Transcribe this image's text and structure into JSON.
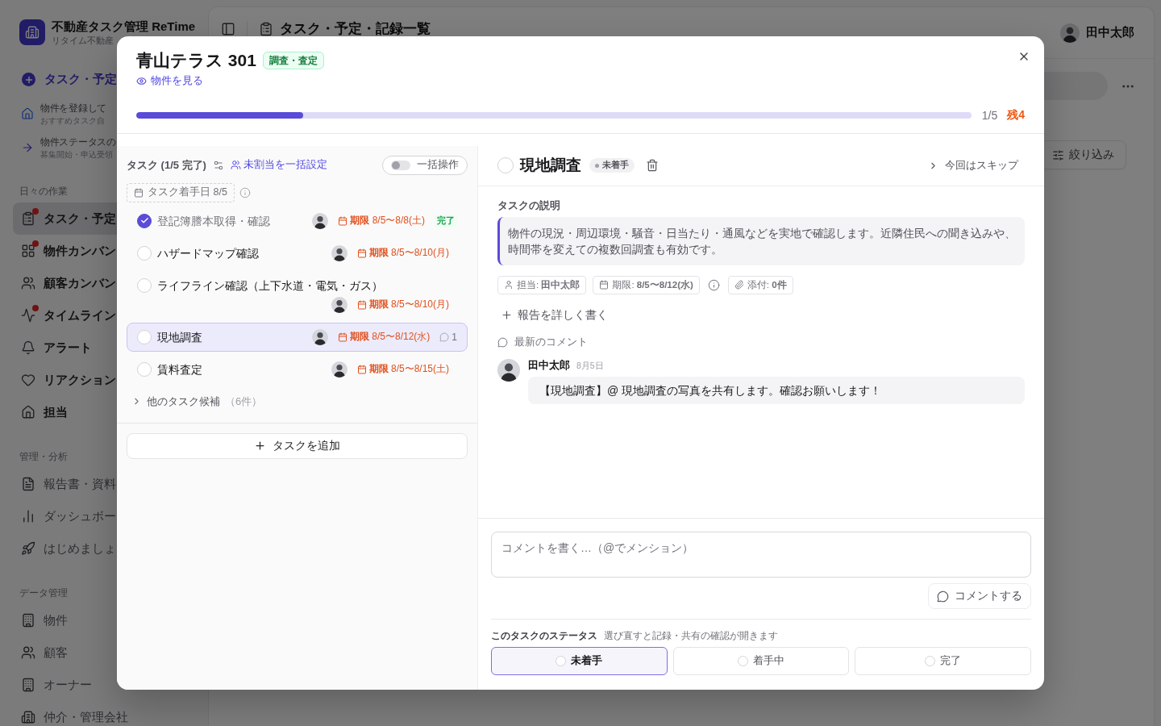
{
  "sidebar": {
    "brand": {
      "title": "不動産タスク管理 ReTime",
      "subtitle": "リタイム不動産"
    },
    "new_button": "タスク・予定",
    "guides": [
      {
        "title": "物件を登録して",
        "subtitle": "おすすめタスク自"
      },
      {
        "title": "物件ステータスの",
        "subtitle": "募集開始・申込受領"
      }
    ],
    "sections": [
      {
        "title": "日々の作業",
        "kind": "primary",
        "items": [
          {
            "label": "タスク・予定",
            "selected": true,
            "alert": true
          },
          {
            "label": "物件カンバン",
            "selected": false,
            "alert": true
          },
          {
            "label": "顧客カンバン",
            "selected": false,
            "alert": false
          },
          {
            "label": "タイムライン",
            "selected": false,
            "alert": true
          },
          {
            "label": "アラート",
            "selected": false,
            "alert": false
          },
          {
            "label": "リアクション",
            "selected": false,
            "alert": false
          },
          {
            "label": "担当",
            "selected": false,
            "alert": false
          }
        ]
      },
      {
        "title": "管理・分析",
        "kind": "secondary",
        "items": [
          {
            "label": "報告書・資料",
            "selected": false,
            "alert": false
          },
          {
            "label": "ダッシュボー",
            "selected": false,
            "alert": false
          },
          {
            "label": "はじめましょ",
            "selected": false,
            "alert": false
          }
        ]
      },
      {
        "title": "データ管理",
        "kind": "secondary",
        "items": [
          {
            "label": "物件",
            "selected": false,
            "alert": false
          },
          {
            "label": "顧客",
            "selected": false,
            "alert": false
          },
          {
            "label": "オーナー",
            "selected": false,
            "alert": false
          },
          {
            "label": "仲介・管理会社",
            "selected": false,
            "alert": false
          }
        ]
      }
    ]
  },
  "main": {
    "title": "タスク・予定・記録一覧",
    "user": "田中太郎",
    "filter_button": "絞り込み"
  },
  "modal": {
    "title": "青山テラス 301",
    "category_badge": "調査・査定",
    "property_link": "物件を見る",
    "progress": {
      "level": 0.2,
      "count": "1/5",
      "remaining": "残4"
    },
    "task_panel": {
      "heading": "タスク (1/5 完了)",
      "bulk_assign_link": "未割当を一括設定",
      "bulk_toggle": {
        "label": "一括操作",
        "on": false
      },
      "start_chip": "タスク着手日 8/5",
      "tasks": [
        {
          "name": "登記簿謄本取得・確認",
          "checked": true,
          "selected": false,
          "deadline": "**期限** 8/5〜8/8(土)",
          "done_badge": "完了"
        },
        {
          "name": "ハザードマップ確認",
          "checked": false,
          "selected": false,
          "deadline": "**期限** 8/5〜8/10(月)"
        },
        {
          "name": "ライフライン確認（上下水道・電気・ガス）",
          "checked": false,
          "selected": false,
          "deadline": "**期限** 8/5〜8/10(月)"
        },
        {
          "name": "現地調査",
          "checked": false,
          "selected": true,
          "deadline": "**期限** 8/5〜8/12(水)",
          "comments": "1"
        },
        {
          "name": "賃料査定",
          "checked": false,
          "selected": false,
          "deadline": "**期限** 8/5〜8/15(土)"
        }
      ],
      "more": {
        "label": "他のタスク候補",
        "count": "（6件）",
        "expanded": false
      },
      "add_button": "タスクを追加"
    },
    "detail": {
      "title": "現地調査",
      "checked": false,
      "status_badge": "未着手",
      "skip_link": "今回はスキップ",
      "description_label": "タスクの説明",
      "description": "物件の現況・周辺環境・騒音・日当たり・通風などを実地で確認します。近隣住民への聞き込みや、時間帯を変えての複数回調査も有効です。",
      "meta_chips": [
        {
          "kind": "assignee",
          "text": "担当: **田中太郎**"
        },
        {
          "kind": "deadline",
          "text": "期限: **8/5〜8/12(水)**"
        },
        {
          "kind": "attachment",
          "text": "添付: **0件**"
        }
      ],
      "report_link": "報告を詳しく書く",
      "comments_label": "最新のコメント",
      "comments": [
        {
          "author": "田中太郎",
          "date": "8月5日",
          "text": "【現地調査】@ 現地調査の写真を共有します。確認お願いします！"
        }
      ],
      "comment_input": {
        "placeholder": "コメントを書く…（@でメンション）"
      },
      "comment_button": "コメントする",
      "status_label": "このタスクのステータス",
      "status_hint": "選び直すと記録・共有の確認が開きます",
      "status_options": [
        {
          "label": "未着手",
          "selected": true
        },
        {
          "label": "着手中",
          "selected": false
        },
        {
          "label": "完了",
          "selected": false
        }
      ]
    }
  }
}
